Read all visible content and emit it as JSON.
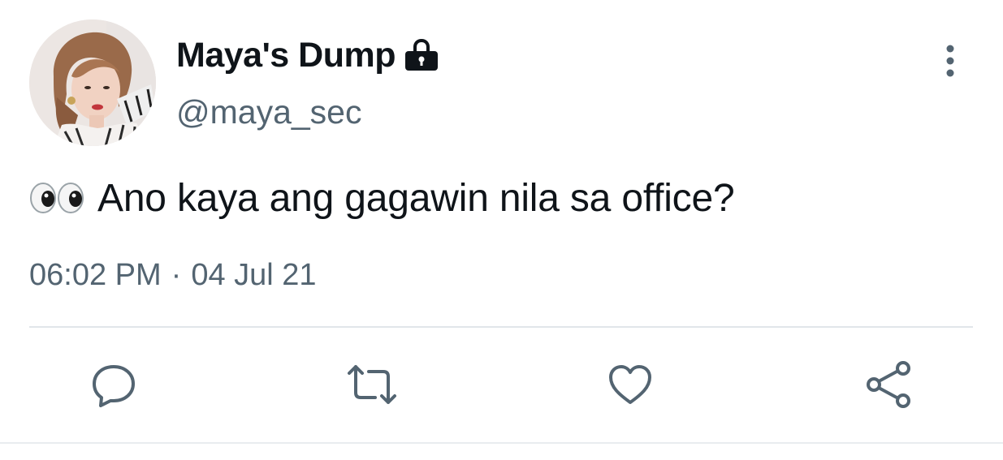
{
  "user": {
    "display_name": "Maya's Dump",
    "handle": "@maya_sec",
    "avatar_icon": "avatar",
    "protected_icon": "lock-icon"
  },
  "tweet": {
    "emoji": "eyes-icon",
    "text": "Ano kaya ang gagawin nila sa office?",
    "time": "06:02 PM",
    "separator": "·",
    "date": "04 Jul 21"
  },
  "actions": [
    {
      "icon": "reply-icon"
    },
    {
      "icon": "retweet-icon"
    },
    {
      "icon": "like-icon"
    },
    {
      "icon": "share-icon"
    }
  ],
  "colors": {
    "text_primary": "#0f1419",
    "text_secondary": "#536471",
    "icon": "#536471",
    "divider": "#e1e6ea"
  }
}
